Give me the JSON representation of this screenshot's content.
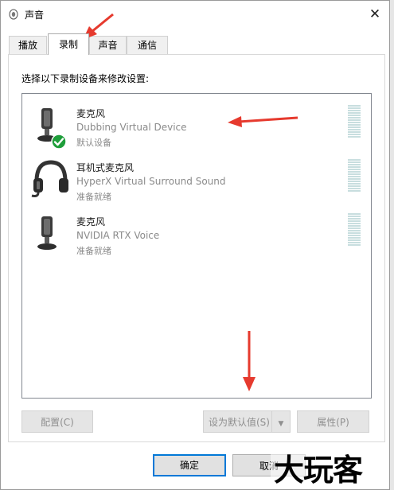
{
  "window": {
    "title": "声音",
    "close_glyph": "✕"
  },
  "tabs": [
    {
      "label": "播放",
      "active": false
    },
    {
      "label": "录制",
      "active": true
    },
    {
      "label": "声音",
      "active": false
    },
    {
      "label": "通信",
      "active": false
    }
  ],
  "instruction": "选择以下录制设备来修改设置:",
  "devices": [
    {
      "name": "麦克风",
      "description": "Dubbing Virtual Device",
      "status": "默认设备",
      "icon": "microphone-icon",
      "is_default": true
    },
    {
      "name": "耳机式麦克风",
      "description": "HyperX Virtual Surround Sound",
      "status": "准备就绪",
      "icon": "headset-icon",
      "is_default": false
    },
    {
      "name": "麦克风",
      "description": "NVIDIA RTX Voice",
      "status": "准备就绪",
      "icon": "microphone-icon",
      "is_default": false
    }
  ],
  "buttons": {
    "configure": "配置(C)",
    "set_default": "设为默认值(S)",
    "properties": "属性(P)",
    "ok": "确定",
    "cancel": "取消"
  },
  "watermark": "大玩客",
  "colors": {
    "accent_blue": "#0078d7",
    "default_check": "#1e9e3a",
    "annotation_arrow": "#e63a2e",
    "meter": "#c8dedf"
  }
}
